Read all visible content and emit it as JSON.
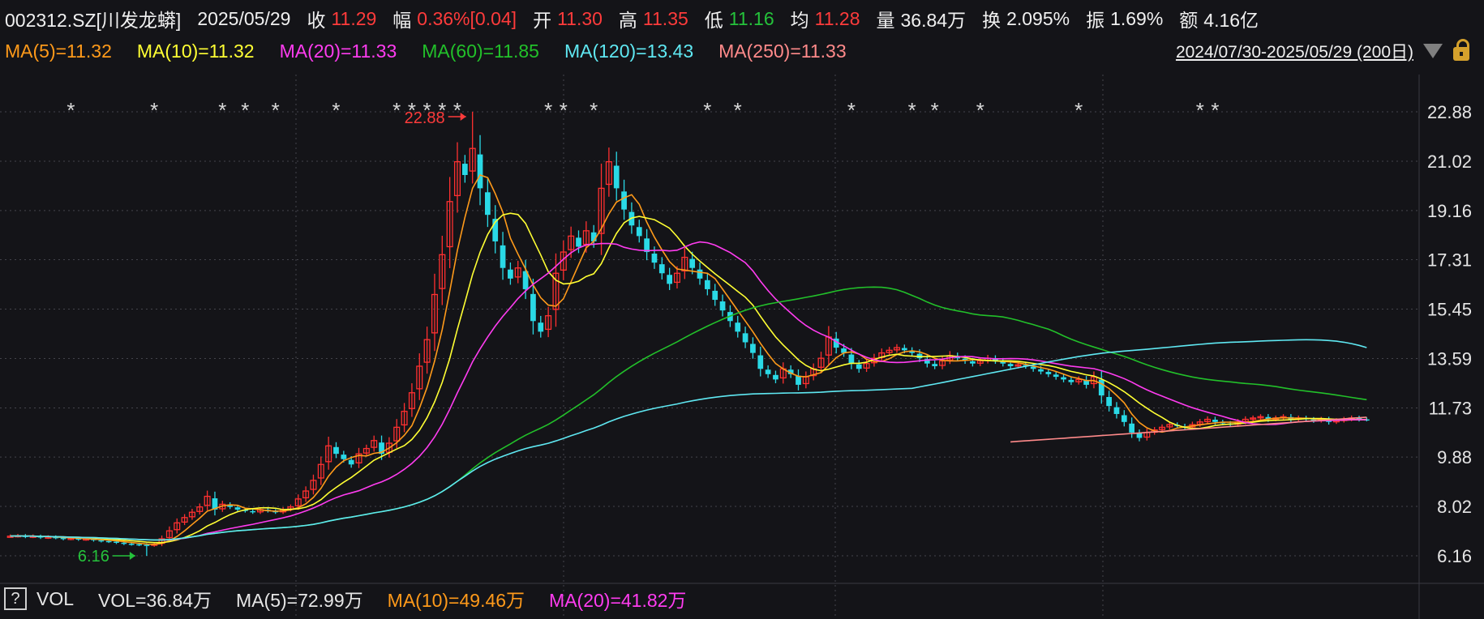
{
  "header": {
    "code": "002312.SZ[川发龙蟒]",
    "date": "2025/05/29",
    "close_label": "收",
    "close": "11.29",
    "change_label": "幅",
    "change": "0.36%[0.04]",
    "open_label": "开",
    "open": "11.30",
    "high_label": "高",
    "high": "11.35",
    "low_label": "低",
    "low": "11.16",
    "avg_label": "均",
    "avg": "11.28",
    "volume_label": "量",
    "volume": "36.84万",
    "turnover_label": "换",
    "turnover": "2.095%",
    "amplitude_label": "振",
    "amplitude": "1.69%",
    "amount_label": "额",
    "amount": "4.16亿"
  },
  "ma_legend": [
    {
      "text": "MA(5)=11.32",
      "color": "#ff9a1a"
    },
    {
      "text": "MA(10)=11.32",
      "color": "#ffff33"
    },
    {
      "text": "MA(20)=11.33",
      "color": "#ff3cf0"
    },
    {
      "text": "MA(60)=11.85",
      "color": "#22c02a"
    },
    {
      "text": "MA(120)=13.43",
      "color": "#5fe8f2"
    },
    {
      "text": "MA(250)=11.33",
      "color": "#ff8a8a"
    }
  ],
  "range_text": "2024/07/30-2025/05/29 (200日)",
  "volume_legend": {
    "help": "?",
    "name": "VOL",
    "vol": "VOL=36.84万",
    "ma5": "MA(5)=72.99万",
    "ma10": "MA(10)=49.46万",
    "ma20": "MA(20)=41.82万",
    "colors": {
      "vol": "#f0f0f0",
      "ma5": "#f0f0f0",
      "ma10": "#ff9a1a",
      "ma20": "#ff3cf0"
    }
  },
  "colors": {
    "up": "#ff3030",
    "down": "#2ad9e6",
    "grid": "#44444c",
    "bg": "#141418"
  },
  "chart_data": {
    "type": "candlestick",
    "y_ticks": [
      "22.88",
      "21.02",
      "19.16",
      "17.31",
      "15.45",
      "13.59",
      "11.73",
      "9.88",
      "8.02",
      "6.16"
    ],
    "ylim": [
      6.16,
      22.88
    ],
    "date_range": [
      "2024/07/30",
      "2025/05/29"
    ],
    "n_days": 200,
    "max_label": "22.88",
    "min_label": "6.16",
    "close": [
      6.9,
      6.92,
      6.88,
      6.9,
      6.85,
      6.87,
      6.84,
      6.8,
      6.82,
      6.78,
      6.8,
      6.75,
      6.72,
      6.7,
      6.66,
      6.62,
      6.6,
      6.58,
      6.55,
      6.6,
      6.8,
      7.1,
      7.4,
      7.6,
      7.8,
      8.0,
      8.4,
      7.9,
      8.1,
      8.0,
      7.9,
      7.85,
      7.8,
      7.9,
      7.85,
      7.8,
      7.9,
      8.0,
      8.3,
      8.6,
      9.0,
      9.6,
      10.3,
      10.0,
      9.8,
      9.6,
      10.0,
      10.2,
      10.5,
      10.0,
      10.4,
      11.0,
      11.6,
      12.3,
      13.3,
      14.3,
      16.0,
      17.5,
      19.5,
      21.0,
      20.5,
      21.5,
      20.0,
      19.0,
      18.0,
      17.0,
      16.6,
      17.0,
      16.2,
      15.0,
      14.6,
      15.2,
      16.8,
      17.6,
      18.2,
      17.8,
      18.4,
      18.0,
      20.0,
      21.0,
      20.0,
      19.2,
      18.6,
      18.2,
      17.6,
      17.2,
      16.8,
      16.4,
      16.8,
      17.4,
      17.0,
      16.6,
      16.2,
      15.8,
      15.4,
      15.0,
      14.6,
      14.2,
      13.8,
      13.2,
      13.0,
      12.8,
      13.2,
      13.0,
      12.6,
      12.9,
      13.2,
      13.6,
      14.4,
      14.0,
      13.8,
      13.4,
      13.2,
      13.4,
      13.6,
      13.8,
      13.9,
      14.0,
      13.9,
      13.8,
      13.6,
      13.4,
      13.3,
      13.5,
      13.7,
      13.6,
      13.5,
      13.4,
      13.5,
      13.6,
      13.5,
      13.4,
      13.3,
      13.35,
      13.3,
      13.2,
      13.1,
      13.0,
      12.9,
      12.8,
      12.7,
      12.8,
      12.6,
      12.9,
      12.2,
      11.8,
      11.5,
      11.2,
      10.8,
      10.6,
      10.8,
      10.9,
      11.0,
      11.1,
      11.05,
      11.0,
      11.1,
      11.2,
      11.3,
      11.2,
      11.15,
      11.1,
      11.2,
      11.3,
      11.35,
      11.4,
      11.3,
      11.35,
      11.4,
      11.3,
      11.35,
      11.3,
      11.25,
      11.3,
      11.2,
      11.25,
      11.3,
      11.35,
      11.3,
      11.29
    ]
  }
}
